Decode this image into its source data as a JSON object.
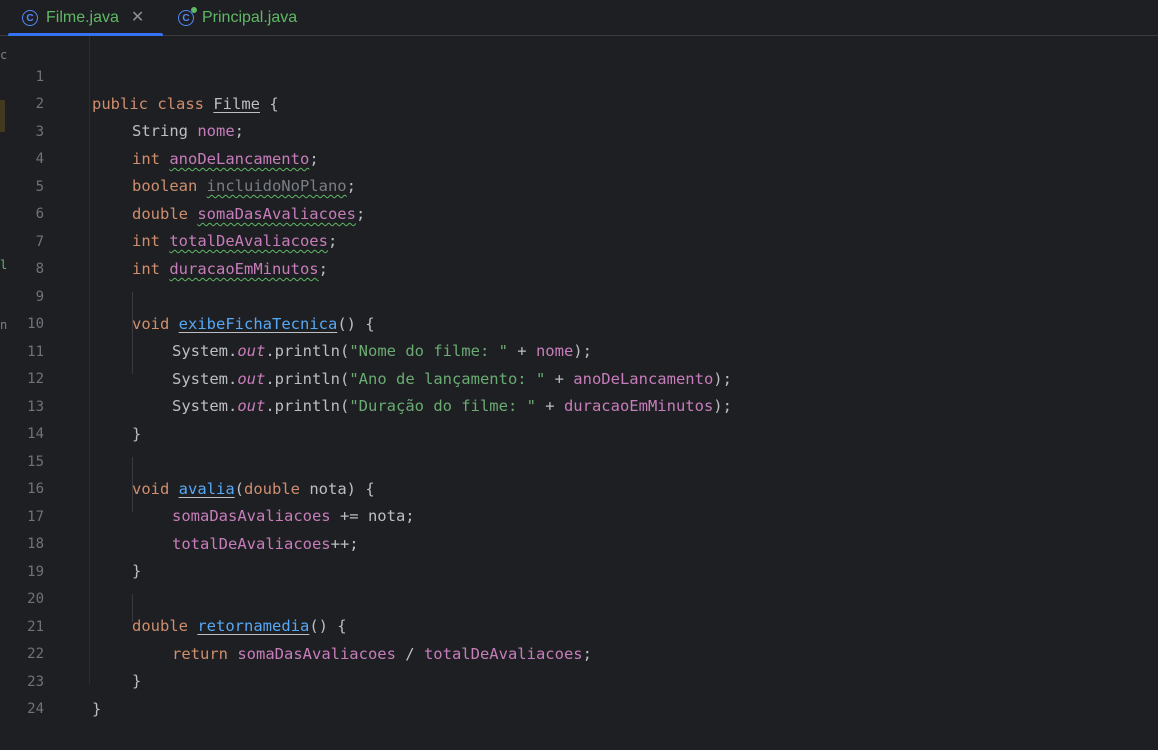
{
  "tabs": [
    {
      "label": "Filme.java",
      "icon": "class-icon",
      "active": true,
      "closable": true
    },
    {
      "label": "Principal.java",
      "icon": "class-run-icon",
      "active": false
    }
  ],
  "colors": {
    "background": "#1e1f22",
    "keyword": "#cf8e6d",
    "field": "#c77dbb",
    "string": "#6aab73",
    "method": "#56a8f5",
    "text": "#bcbec4",
    "line_number": "#6f737a",
    "active_tab_underline": "#3574f0"
  },
  "line_numbers": [
    "1",
    "2",
    "3",
    "4",
    "5",
    "6",
    "7",
    "8",
    "9",
    "10",
    "11",
    "12",
    "13",
    "14",
    "15",
    "16",
    "17",
    "18",
    "19",
    "20",
    "21",
    "22",
    "23",
    "24"
  ],
  "code": {
    "l1": {
      "kw": "public class ",
      "name": "Filme",
      "rest": " {"
    },
    "l2": {
      "type": "String ",
      "field": "nome",
      "end": ";"
    },
    "l3": {
      "type": "int ",
      "field": "anoDeLancamento",
      "end": ";"
    },
    "l4": {
      "type": "boolean ",
      "field": "incluidoNoPlano",
      "end": ";"
    },
    "l5": {
      "type": "double ",
      "field": "somaDasAvaliacoes",
      "end": ";"
    },
    "l6": {
      "type": "int ",
      "field": "totalDeAvaliacoes",
      "end": ";"
    },
    "l7": {
      "type": "int ",
      "field": "duracaoEmMinutos",
      "end": ";"
    },
    "l9": {
      "type": "void ",
      "method": "exibeFichaTecnica",
      "rest": "() {"
    },
    "l10": {
      "sys": "System.",
      "out": "out",
      "println": ".println(",
      "str": "\"Nome do filme: \"",
      "plus": " + ",
      "field": "nome",
      "end": ");"
    },
    "l11": {
      "sys": "System.",
      "out": "out",
      "println": ".println(",
      "str": "\"Ano de lançamento: \"",
      "plus": " + ",
      "field": "anoDeLancamento",
      "end": ");"
    },
    "l12": {
      "sys": "System.",
      "out": "out",
      "println": ".println(",
      "str": "\"Duração do filme: \"",
      "plus": " + ",
      "field": "duracaoEmMinutos",
      "end": ");"
    },
    "l13": {
      "text": "}"
    },
    "l15": {
      "type": "void ",
      "method": "avalia",
      "open": "(",
      "ptype": "double ",
      "param": "nota",
      "rest": ") {"
    },
    "l16": {
      "field": "somaDasAvaliacoes",
      "rest": " += nota;"
    },
    "l17": {
      "field": "totalDeAvaliacoes",
      "rest": "++;"
    },
    "l18": {
      "text": "}"
    },
    "l20": {
      "type": "double ",
      "method": "retornamedia",
      "rest": "() {"
    },
    "l21": {
      "kw": "return ",
      "f1": "somaDasAvaliacoes",
      "op": " / ",
      "f2": "totalDeAvaliacoes",
      "end": ";"
    },
    "l22": {
      "text": "}"
    },
    "l23": {
      "text": "}"
    }
  }
}
